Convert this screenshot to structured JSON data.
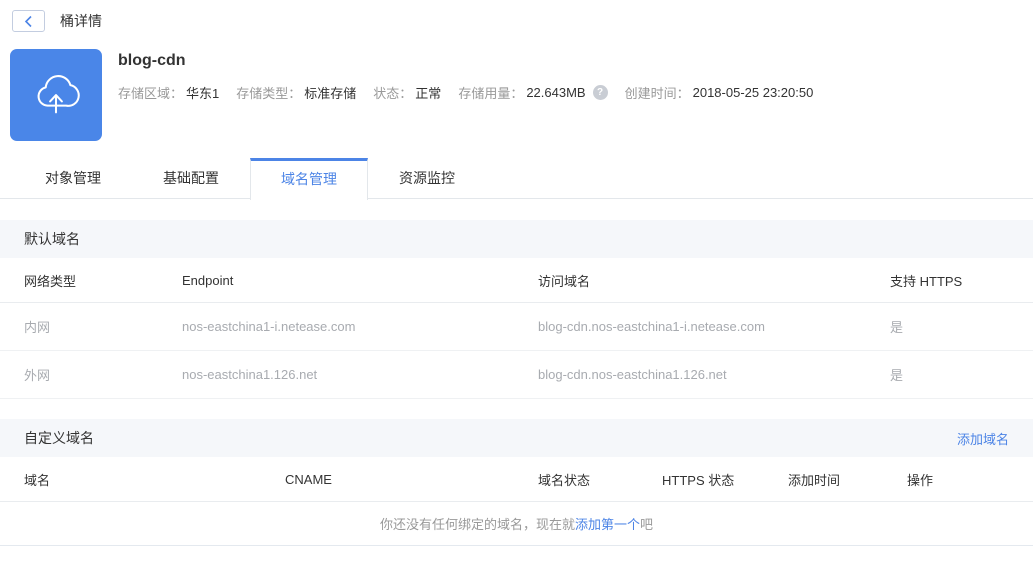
{
  "topbar": {
    "title": "桶详情"
  },
  "bucket": {
    "name": "blog-cdn",
    "info": [
      {
        "label": "存储区域：",
        "value": "华东1"
      },
      {
        "label": "存储类型：",
        "value": "标准存储"
      },
      {
        "label": "状态：",
        "value": "正常"
      },
      {
        "label": "存储用量：",
        "value": "22.643MB",
        "help_icon": "question-circle"
      },
      {
        "label": "创建时间：",
        "value": "2018-05-25 23:20:50"
      }
    ]
  },
  "tabs": [
    {
      "id": "object-management",
      "label": "对象管理",
      "active": false
    },
    {
      "id": "basic-config",
      "label": "基础配置",
      "active": false
    },
    {
      "id": "domain-management",
      "label": "域名管理",
      "active": true
    },
    {
      "id": "resource-monitor",
      "label": "资源监控",
      "active": false
    }
  ],
  "default_domains": {
    "title": "默认域名",
    "columns": [
      "网络类型",
      "Endpoint",
      "访问域名",
      "支持 HTTPS"
    ],
    "rows": [
      [
        "内网",
        "nos-eastchina1-i.netease.com",
        "blog-cdn.nos-eastchina1-i.netease.com",
        "是"
      ],
      [
        "外网",
        "nos-eastchina1.126.net",
        "blog-cdn.nos-eastchina1.126.net",
        "是"
      ]
    ]
  },
  "custom_domains": {
    "title": "自定义域名",
    "add_button": "添加域名",
    "columns": [
      "域名",
      "CNAME",
      "域名状态",
      "HTTPS 状态",
      "添加时间",
      "操作"
    ],
    "rows": [],
    "empty_text_prefix": "你还没有任何绑定的域名，现在就",
    "empty_text_link": "添加第一个",
    "empty_text_suffix": "吧"
  },
  "colors": {
    "accent": "#4c84e6",
    "icon_bg": "#4a86e8",
    "section_bg": "#f5f7fa"
  }
}
